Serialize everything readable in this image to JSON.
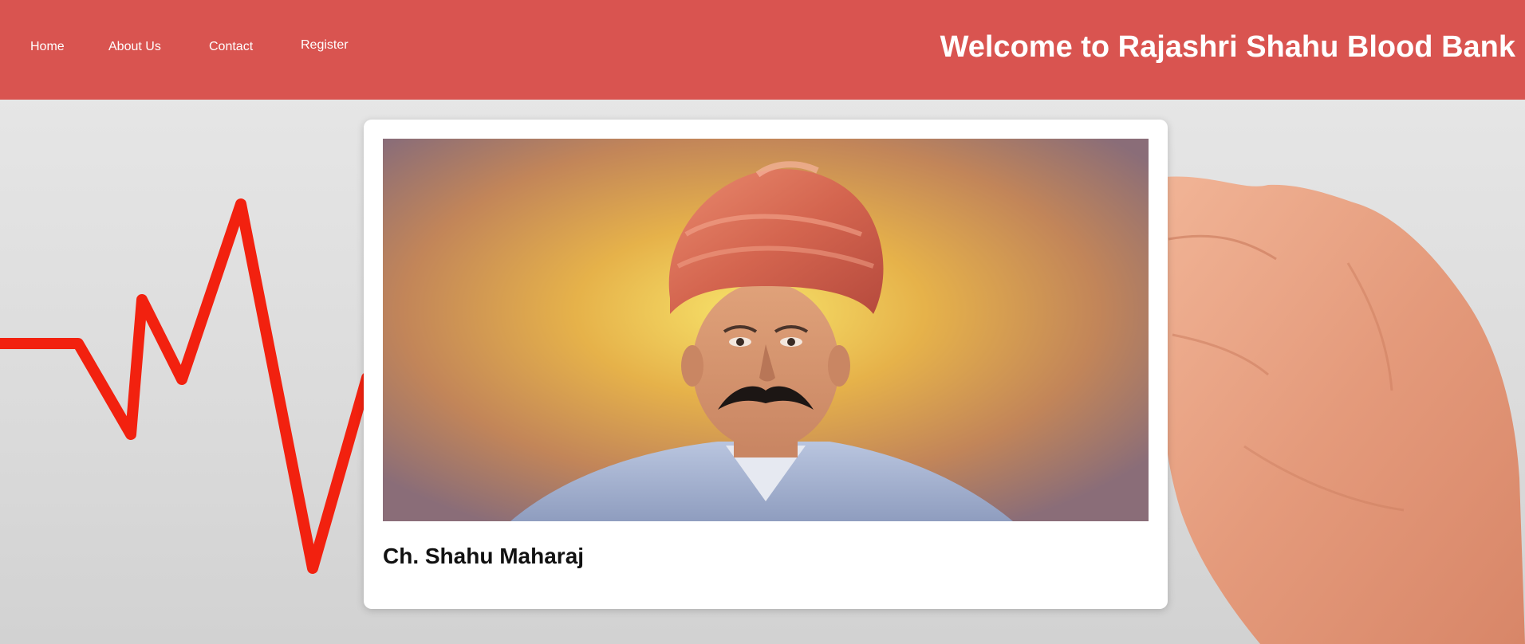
{
  "header": {
    "title": "Welcome to Rajashri Shahu Blood Bank",
    "background_color": "#d95450",
    "nav": [
      {
        "label": "Home"
      },
      {
        "label": "About Us"
      },
      {
        "label": "Contact"
      },
      {
        "label": "Register"
      }
    ]
  },
  "background": {
    "heartbeat_line_color": "#f2210f",
    "decorations": [
      "heartbeat-line",
      "hand"
    ]
  },
  "card": {
    "image": "portrait",
    "caption": "Ch. Shahu Maharaj"
  }
}
